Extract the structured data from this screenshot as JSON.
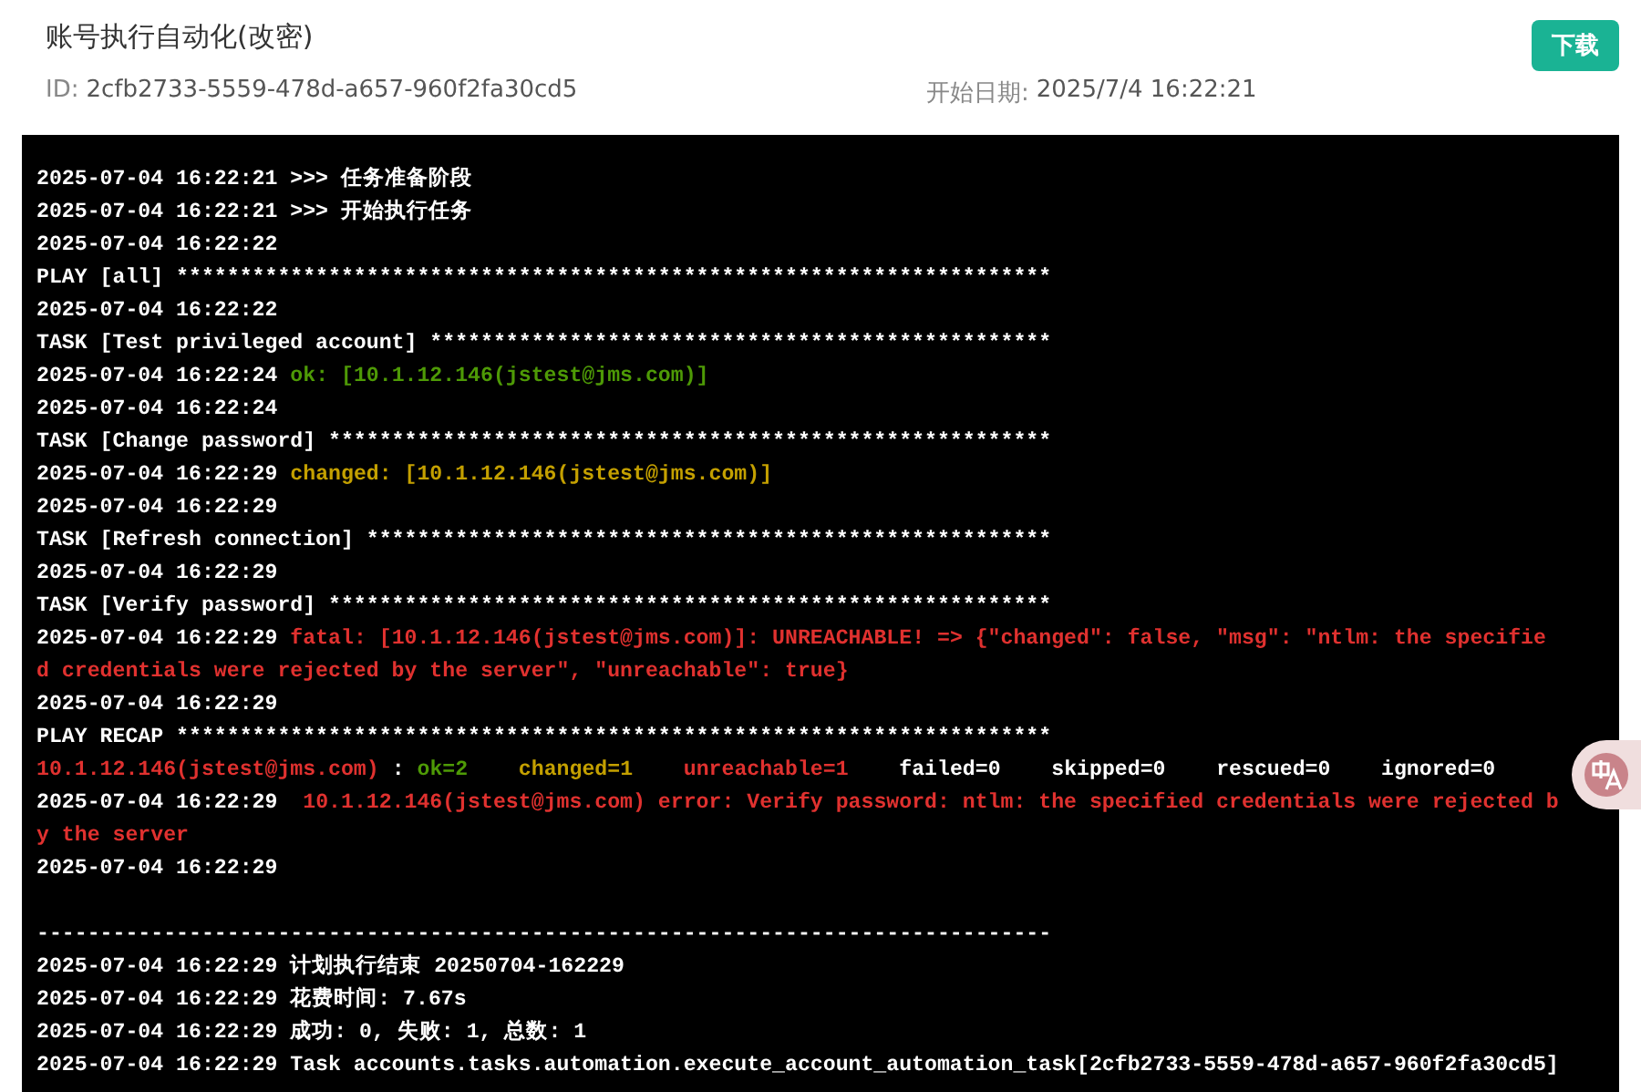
{
  "header": {
    "title": "账号执行自动化(改密)",
    "download_button": "下载",
    "fields": [
      {
        "label": "ID:",
        "value": "2cfb2733-5559-478d-a657-960f2fa30cd5"
      },
      {
        "label": "开始日期:",
        "value": "2025/7/4 16:22:21"
      }
    ]
  },
  "log": [
    {
      "kind": "text",
      "segments": [
        {
          "text": "2025-07-04 16:22:21 >>> 任务准备阶段",
          "color": "#ffffff"
        }
      ]
    },
    {
      "kind": "text",
      "segments": [
        {
          "text": "2025-07-04 16:22:21 >>> 开始执行任务",
          "color": "#ffffff"
        }
      ]
    },
    {
      "kind": "text",
      "segments": [
        {
          "text": "2025-07-04 16:22:22",
          "color": "#ffffff"
        }
      ]
    },
    {
      "kind": "text",
      "segments": [
        {
          "text": "PLAY [all] *********************************************************************",
          "color": "#ffffff"
        }
      ]
    },
    {
      "kind": "text",
      "segments": [
        {
          "text": "2025-07-04 16:22:22",
          "color": "#ffffff"
        }
      ]
    },
    {
      "kind": "text",
      "segments": [
        {
          "text": "TASK [Test privileged account] *************************************************",
          "color": "#ffffff"
        }
      ]
    },
    {
      "kind": "text",
      "segments": [
        {
          "text": "2025-07-04 16:22:24 ",
          "color": "#ffffff"
        },
        {
          "text": "ok: [10.1.12.146(jstest@jms.com)]",
          "color": "#4e9a06"
        }
      ]
    },
    {
      "kind": "text",
      "segments": [
        {
          "text": "2025-07-04 16:22:24",
          "color": "#ffffff"
        }
      ]
    },
    {
      "kind": "text",
      "segments": [
        {
          "text": "TASK [Change password] *********************************************************",
          "color": "#ffffff"
        }
      ]
    },
    {
      "kind": "text",
      "segments": [
        {
          "text": "2025-07-04 16:22:29 ",
          "color": "#ffffff"
        },
        {
          "text": "changed: [10.1.12.146(jstest@jms.com)]",
          "color": "#c4a000"
        }
      ]
    },
    {
      "kind": "text",
      "segments": [
        {
          "text": "2025-07-04 16:22:29",
          "color": "#ffffff"
        }
      ]
    },
    {
      "kind": "text",
      "segments": [
        {
          "text": "TASK [Refresh connection] ******************************************************",
          "color": "#ffffff"
        }
      ]
    },
    {
      "kind": "text",
      "segments": [
        {
          "text": "2025-07-04 16:22:29",
          "color": "#ffffff"
        }
      ]
    },
    {
      "kind": "text",
      "segments": [
        {
          "text": "TASK [Verify password] *********************************************************",
          "color": "#ffffff"
        }
      ]
    },
    {
      "kind": "text",
      "segments": [
        {
          "text": "2025-07-04 16:22:29 ",
          "color": "#ffffff"
        },
        {
          "text": "fatal: [10.1.12.146(jstest@jms.com)]: UNREACHABLE! => {\"changed\": false, \"msg\": \"ntlm: the specified credentials were rejected by the server\", \"unreachable\": true}",
          "color": "#e0312f"
        }
      ]
    },
    {
      "kind": "text",
      "segments": [
        {
          "text": "2025-07-04 16:22:29",
          "color": "#ffffff"
        }
      ]
    },
    {
      "kind": "text",
      "segments": [
        {
          "text": "PLAY RECAP *********************************************************************",
          "color": "#ffffff"
        }
      ]
    },
    {
      "kind": "text",
      "segments": [
        {
          "text": "10.1.12.146(jstest@jms.com)",
          "color": "#e0312f"
        },
        {
          "text": " : ",
          "color": "#ffffff"
        },
        {
          "text": "ok=2",
          "color": "#4e9a06"
        },
        {
          "text": "    changed=1",
          "color": "#c4a000"
        },
        {
          "text": "    unreachable=1",
          "color": "#e0312f"
        },
        {
          "text": "    failed=0    skipped=0    rescued=0    ignored=0",
          "color": "#ffffff"
        }
      ]
    },
    {
      "kind": "text",
      "segments": [
        {
          "text": "2025-07-04 16:22:29  ",
          "color": "#ffffff"
        },
        {
          "text": "10.1.12.146(jstest@jms.com) error: Verify password: ntlm: the specified credentials were rejected by the server",
          "color": "#e0312f"
        }
      ]
    },
    {
      "kind": "text",
      "segments": [
        {
          "text": "2025-07-04 16:22:29",
          "color": "#ffffff"
        }
      ]
    },
    {
      "kind": "blank"
    },
    {
      "kind": "text",
      "segments": [
        {
          "text": "--------------------------------------------------------------------------------",
          "color": "#ffffff"
        }
      ]
    },
    {
      "kind": "text",
      "segments": [
        {
          "text": "2025-07-04 16:22:29 计划执行结束 20250704-162229",
          "color": "#ffffff"
        }
      ]
    },
    {
      "kind": "text",
      "segments": [
        {
          "text": "2025-07-04 16:22:29 花费时间: 7.67s",
          "color": "#ffffff"
        }
      ]
    },
    {
      "kind": "text",
      "segments": [
        {
          "text": "2025-07-04 16:22:29 成功: 0, 失败: 1, 总数: 1",
          "color": "#ffffff"
        }
      ]
    },
    {
      "kind": "text",
      "segments": [
        {
          "text": "2025-07-04 16:22:29 Task accounts.tasks.automation.execute_account_automation_task[2cfb2733-5559-478d-a657-960f2fa30cd5]",
          "color": "#ffffff"
        }
      ]
    }
  ]
}
